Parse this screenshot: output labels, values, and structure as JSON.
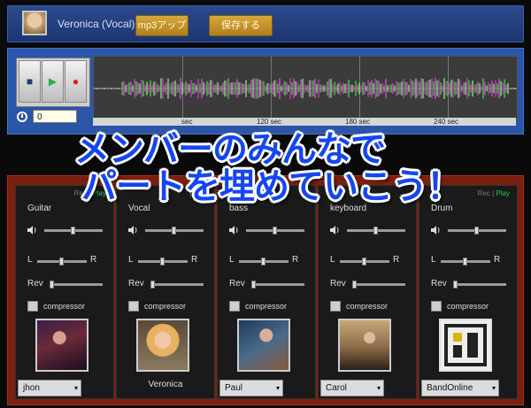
{
  "header": {
    "user_label": "Veronica (Vocal)",
    "upload_button": "mp3アップ",
    "save_button": "保存する"
  },
  "transport": {
    "time_value": "0",
    "ticks": [
      "sec",
      "120 sec",
      "180 sec",
      "240 sec"
    ]
  },
  "tracks": [
    {
      "recplay": [
        "Rec",
        "Play"
      ],
      "name": "Guitar",
      "compressor": "compressor",
      "member": "jhon",
      "member_display": "select"
    },
    {
      "recplay": [
        "",
        "Play"
      ],
      "name": "Vocal",
      "compressor": "compressor",
      "member": "Veronica",
      "member_display": "text"
    },
    {
      "recplay": [
        "",
        ""
      ],
      "name": "bass",
      "compressor": "compressor",
      "member": "Paul",
      "member_display": "select"
    },
    {
      "recplay": [
        "",
        ""
      ],
      "name": "keyboard",
      "compressor": "compressor",
      "member": "Carol",
      "member_display": "select"
    },
    {
      "recplay": [
        "Rec",
        "Play"
      ],
      "name": "Drum",
      "compressor": "compressor",
      "member": "BandOnline",
      "member_display": "select"
    }
  ],
  "labels": {
    "L": "L",
    "R": "R",
    "Rev": "Rev"
  },
  "banner": {
    "line1": "メンバーのみんなで",
    "line2": "パートを埋めていこう！"
  },
  "colors": {
    "accent": "#1446f2",
    "play": "#22c35a",
    "mixer_bg": "#7a1f10"
  }
}
